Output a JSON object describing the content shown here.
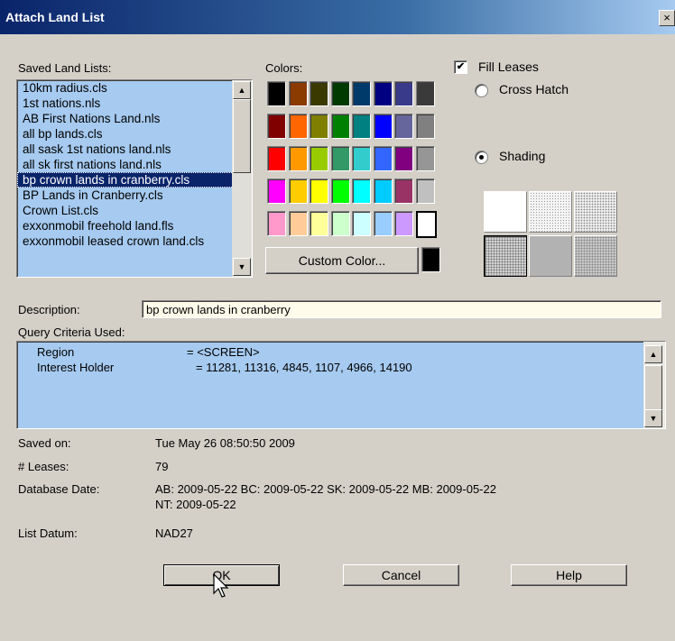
{
  "window": {
    "title": "Attach Land List",
    "close_glyph": "×"
  },
  "saved_lists": {
    "label": "Saved Land Lists:",
    "items": [
      "10km radius.cls",
      "1st nations.nls",
      "AB First Nations Land.nls",
      "all bp lands.cls",
      "all sask 1st nations land.nls",
      "all sk first nations land.nls",
      "bp crown lands in cranberry.cls",
      "BP Lands in Cranberry.cls",
      "Crown List.cls",
      "exxonmobil freehold land.fls",
      "exxonmobil leased crown land.cls"
    ],
    "selected_index": 6
  },
  "colors": {
    "label": "Colors:",
    "rows": [
      [
        "#000000",
        "#8b3a00",
        "#3a3a00",
        "#003a00",
        "#003a6a",
        "#000080",
        "#3a3a8b",
        "#3a3a3a"
      ],
      [
        "#800000",
        "#ff6600",
        "#808000",
        "#008000",
        "#008080",
        "#0000ff",
        "#66669c",
        "#808080"
      ],
      [
        "#ff0000",
        "#ff9900",
        "#99cc00",
        "#339966",
        "#33cccc",
        "#3366ff",
        "#800080",
        "#969696"
      ],
      [
        "#ff00ff",
        "#ffcc00",
        "#ffff00",
        "#00ff00",
        "#00ffff",
        "#00ccff",
        "#993366",
        "#c0c0c0"
      ],
      [
        "#ff99cc",
        "#ffcc99",
        "#ffff99",
        "#ccffcc",
        "#ccffff",
        "#99ccff",
        "#cc99ff",
        "#ffffff"
      ]
    ],
    "custom_button": "Custom Color...",
    "custom_swatch_color": "#000000"
  },
  "fill": {
    "fill_leases_label": "Fill Leases",
    "fill_leases_checked": true,
    "check_glyph": "✔",
    "cross_hatch_label": "Cross Hatch",
    "shading_label": "Shading",
    "selected_mode": "Shading"
  },
  "form": {
    "description_label": "Description:",
    "description_value": "bp crown lands in cranberry",
    "query_label": "Query Criteria Used:",
    "query_rows": [
      {
        "key": "Region",
        "value": "= <SCREEN>"
      },
      {
        "key": "Interest Holder",
        "value": "= 11281, 11316, 4845, 1107, 4966, 14190"
      }
    ],
    "saved_on_label": "Saved on:",
    "saved_on_value": "Tue May 26 08:50:50 2009",
    "leases_label": "# Leases:",
    "leases_value": "79",
    "db_date_label": "Database Date:",
    "db_date_line1": "AB: 2009-05-22  BC: 2009-05-22  SK: 2009-05-22  MB: 2009-05-22",
    "db_date_line2": "NT: 2009-05-22",
    "datum_label": "List Datum:",
    "datum_value": "NAD27"
  },
  "buttons": {
    "ok": "OK",
    "cancel": "Cancel",
    "help": "Help"
  },
  "scroll_glyphs": {
    "up": "▲",
    "down": "▼"
  }
}
